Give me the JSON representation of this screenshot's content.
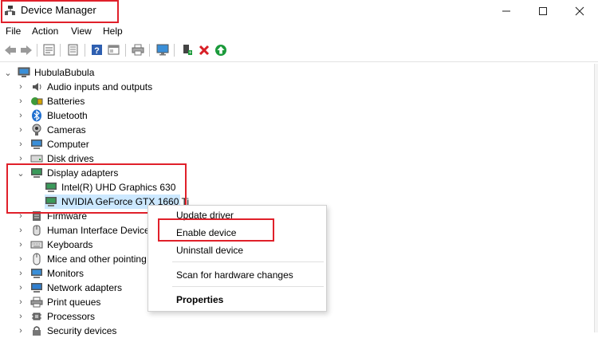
{
  "window": {
    "title": "Device Manager",
    "controls": [
      "minimize",
      "maximize",
      "close"
    ]
  },
  "menu": [
    "File",
    "Action",
    "View",
    "Help"
  ],
  "toolbar": [
    "back-icon",
    "forward-icon",
    "properties-icon",
    "update-icon",
    "help-icon",
    "show-hidden-icon",
    "print-icon",
    "monitor-icon",
    "add-driver-icon",
    "uninstall-icon",
    "enable-icon"
  ],
  "tree": {
    "root": "HubulaBubula",
    "items": [
      {
        "label": "Audio inputs and outputs",
        "icon": "speaker-icon"
      },
      {
        "label": "Batteries",
        "icon": "battery-icon"
      },
      {
        "label": "Bluetooth",
        "icon": "bluetooth-icon"
      },
      {
        "label": "Cameras",
        "icon": "camera-icon"
      },
      {
        "label": "Computer",
        "icon": "computer-icon"
      },
      {
        "label": "Disk drives",
        "icon": "disk-icon"
      },
      {
        "label": "Display adapters",
        "icon": "display-adapter-icon",
        "expanded": true,
        "children": [
          {
            "label": "Intel(R) UHD Graphics 630",
            "icon": "gpu-icon"
          },
          {
            "label": "NVIDIA GeForce GTX 1660 Ti",
            "icon": "gpu-icon",
            "selected": true
          }
        ]
      },
      {
        "label": "Firmware",
        "icon": "firmware-icon"
      },
      {
        "label": "Human Interface Devices",
        "icon": "hid-icon"
      },
      {
        "label": "Keyboards",
        "icon": "keyboard-icon"
      },
      {
        "label": "Mice and other pointing",
        "icon": "mouse-icon"
      },
      {
        "label": "Monitors",
        "icon": "monitor-icon"
      },
      {
        "label": "Network adapters",
        "icon": "network-icon"
      },
      {
        "label": "Print queues",
        "icon": "printer-icon"
      },
      {
        "label": "Processors",
        "icon": "processor-icon"
      },
      {
        "label": "Security devices",
        "icon": "security-icon"
      }
    ]
  },
  "context_menu": {
    "items": [
      "Update driver",
      "Enable device",
      "Uninstall device",
      "Scan for hardware changes",
      "Properties"
    ]
  },
  "colors": {
    "highlight": "#e0202a",
    "selection": "#cce8ff"
  }
}
